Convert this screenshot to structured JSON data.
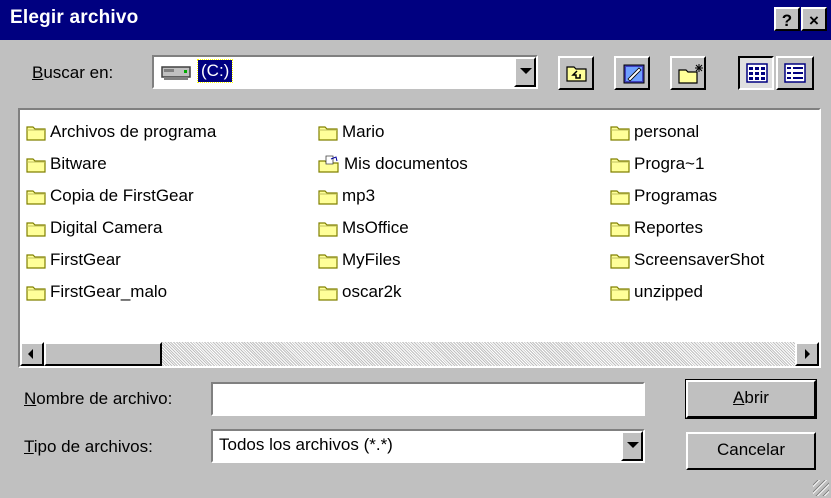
{
  "window": {
    "title": "Elegir archivo",
    "help_label": "?",
    "close_label": "×"
  },
  "lookin": {
    "label_key": "B",
    "label_rest": "uscar en:",
    "value": "(C:)"
  },
  "files": {
    "columns": [
      [
        {
          "name": "Archivos de programa",
          "icon": "folder-icon"
        },
        {
          "name": "Bitware",
          "icon": "folder-icon"
        },
        {
          "name": "Copia de FirstGear",
          "icon": "folder-icon"
        },
        {
          "name": "Digital Camera",
          "icon": "folder-icon"
        },
        {
          "name": "FirstGear",
          "icon": "folder-icon"
        },
        {
          "name": "FirstGear_malo",
          "icon": "folder-icon"
        }
      ],
      [
        {
          "name": "Mario",
          "icon": "folder-icon"
        },
        {
          "name": "Mis documentos",
          "icon": "my-documents-icon"
        },
        {
          "name": "mp3",
          "icon": "folder-icon"
        },
        {
          "name": "MsOffice",
          "icon": "folder-icon"
        },
        {
          "name": "MyFiles",
          "icon": "folder-icon"
        },
        {
          "name": "oscar2k",
          "icon": "folder-icon"
        }
      ],
      [
        {
          "name": "personal",
          "icon": "folder-icon"
        },
        {
          "name": "Progra~1",
          "icon": "folder-icon"
        },
        {
          "name": "Programas",
          "icon": "folder-icon"
        },
        {
          "name": "Reportes",
          "icon": "folder-icon"
        },
        {
          "name": "ScreensaverShot",
          "icon": "folder-icon"
        },
        {
          "name": "unzipped",
          "icon": "folder-icon"
        }
      ]
    ]
  },
  "filename": {
    "label_key": "N",
    "label_rest": "ombre de archivo:",
    "value": ""
  },
  "filetype": {
    "label_key": "T",
    "label_rest": "ipo de archivos:",
    "value": "Todos los archivos (*.*)"
  },
  "buttons": {
    "open_key": "A",
    "open_rest": "brir",
    "cancel_label": "Cancelar"
  },
  "colors": {
    "titlebar": "#000080",
    "face": "#c0c0c0",
    "folder": "#ffff99"
  }
}
